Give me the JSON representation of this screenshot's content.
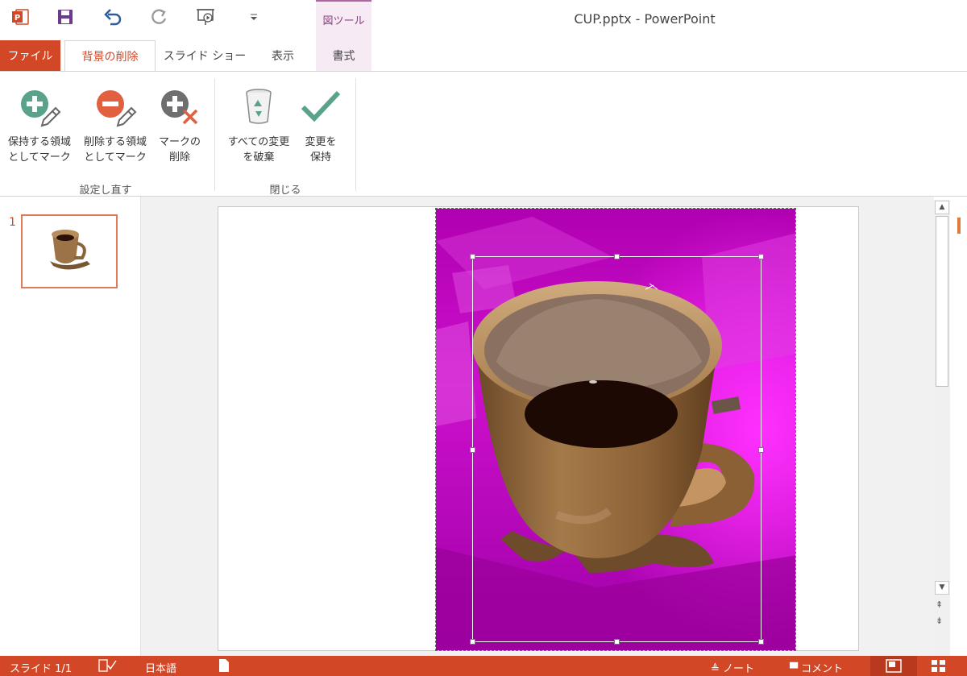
{
  "window": {
    "title": "CUP.pptx - PowerPoint"
  },
  "quick_access": {
    "icons": [
      "powerpoint-app-icon",
      "save-icon",
      "undo-icon",
      "redo-icon",
      "slideshow-start-icon",
      "customize-qat-icon"
    ]
  },
  "context_tab_header": "図ツール",
  "tabs": [
    {
      "label": "ファイル"
    },
    {
      "label": "背景の削除"
    },
    {
      "label": "スライド ショー"
    },
    {
      "label": "表示"
    },
    {
      "label": "書式"
    }
  ],
  "ribbon": {
    "refine_group": {
      "label": "設定し直す",
      "buttons": [
        {
          "line1": "保持する領域",
          "line2": "としてマーク",
          "icon": "mark-keep-icon"
        },
        {
          "line1": "削除する領域",
          "line2": "としてマーク",
          "icon": "mark-remove-icon"
        },
        {
          "line1": "マークの",
          "line2": "削除",
          "icon": "delete-mark-icon"
        }
      ]
    },
    "close_group": {
      "label": "閉じる",
      "buttons": [
        {
          "line1": "すべての変更",
          "line2": "を破棄",
          "icon": "discard-trash-icon"
        },
        {
          "line1": "変更を",
          "line2": "保持",
          "icon": "keep-checkmark-icon"
        }
      ]
    }
  },
  "thumbnails": [
    {
      "number": "1"
    }
  ],
  "status_bar": {
    "slide_info": "スライド 1/1",
    "language": "日本語",
    "notes": "ノート",
    "comments": "コメント"
  },
  "colors": {
    "accent": "#d24726",
    "context_tab": "#f6eaf4",
    "removal_overlay": "#c000c0"
  }
}
